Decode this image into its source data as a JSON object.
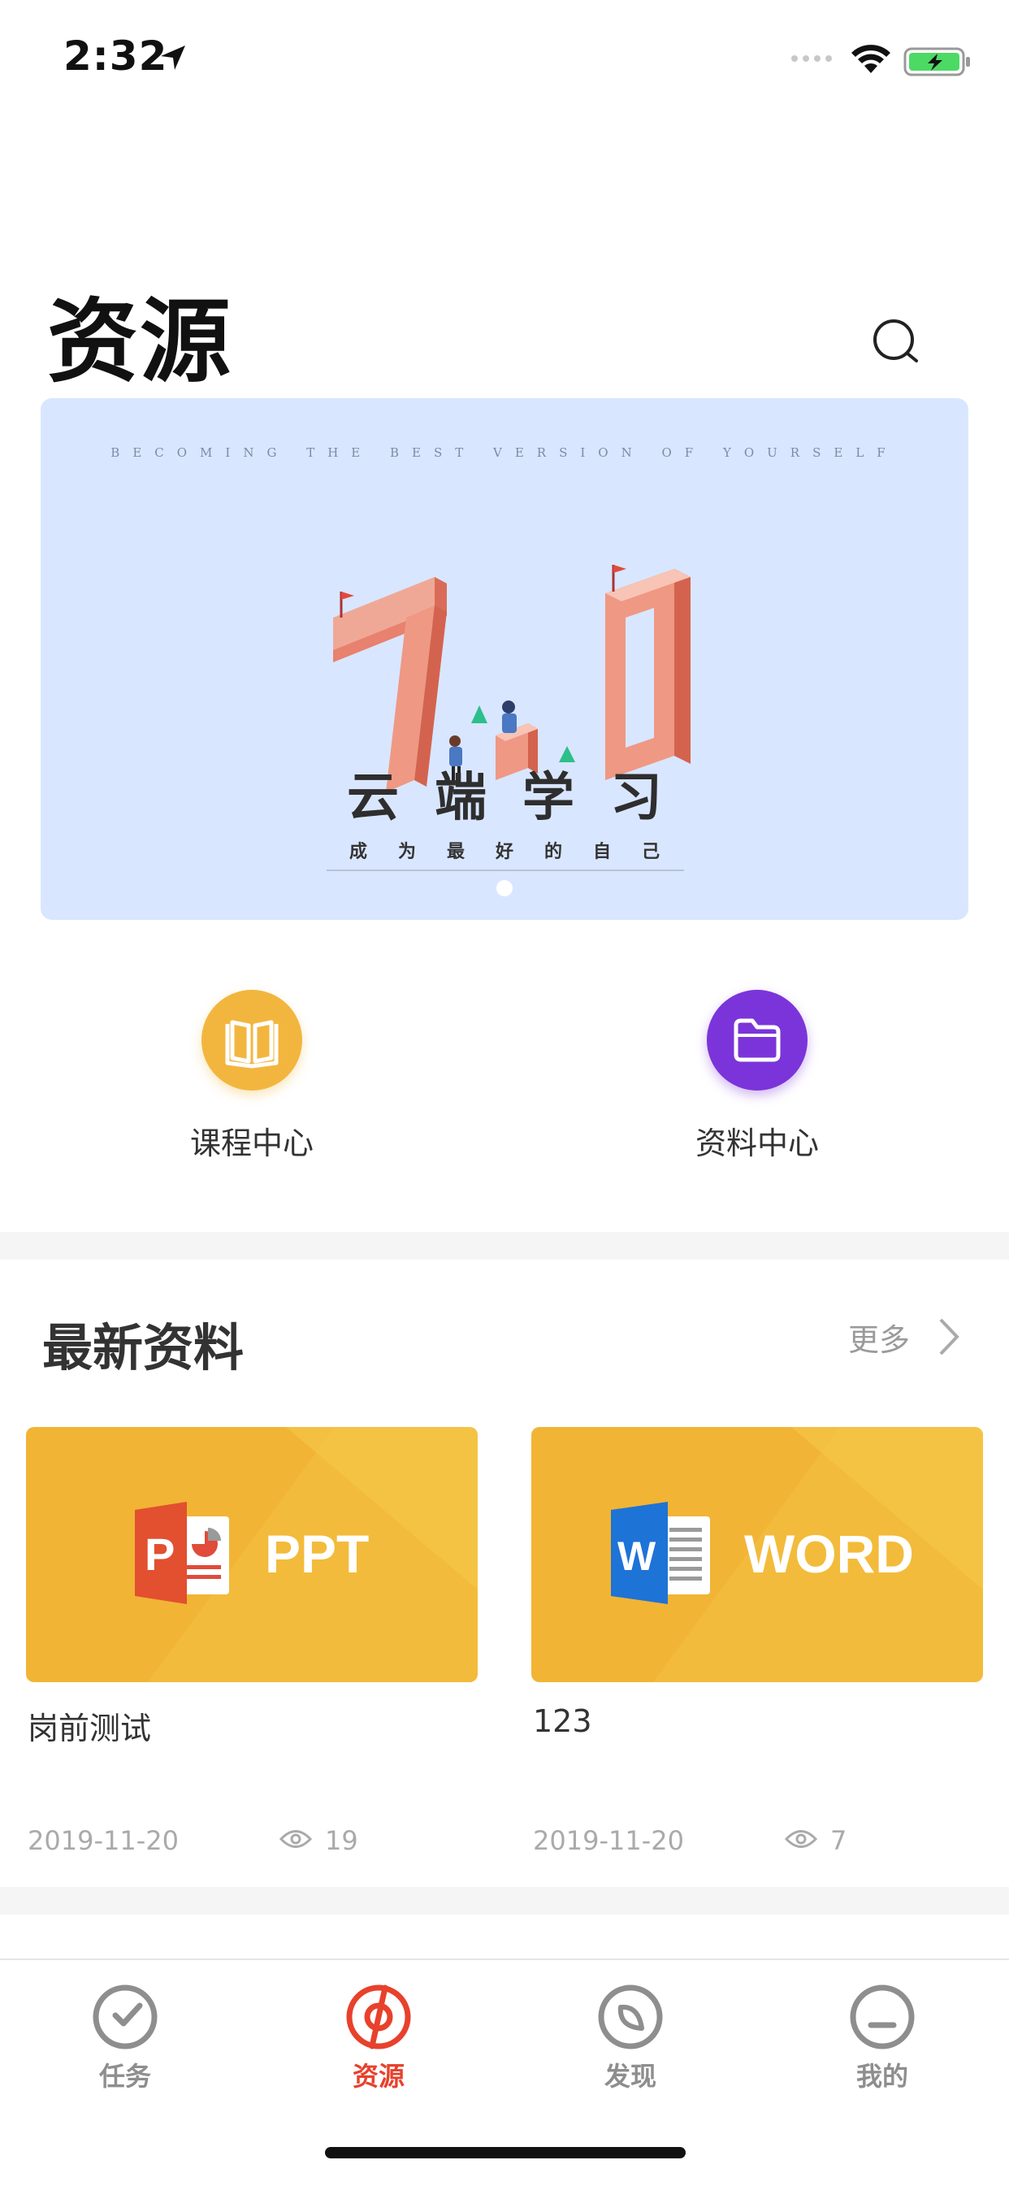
{
  "status_bar": {
    "time": "2:32",
    "icons": [
      "location-arrow-icon",
      "signal-icon",
      "wifi-icon",
      "battery-charging-icon"
    ]
  },
  "header": {
    "title": "资源",
    "search_icon": "search-icon"
  },
  "banner": {
    "tagline": "BECOMING THE BEST VERSION OF YOURSELF",
    "art_text": "7.0",
    "heading": "云端学习",
    "subtitle": "成为最好的自己",
    "page_indicator": {
      "count": 1,
      "active": 1
    },
    "bg_color": "#d9e6ff"
  },
  "shortcuts": [
    {
      "label": "课程中心",
      "icon": "book-icon",
      "color": "#f2b63f"
    },
    {
      "label": "资料中心",
      "icon": "folder-icon",
      "color": "#7b34d9"
    }
  ],
  "latest": {
    "title": "最新资料",
    "more_label": "更多",
    "items": [
      {
        "type_label": "PPT",
        "letter": "P",
        "icon": "powerpoint-icon",
        "title": "岗前测试",
        "date": "2019-11-20",
        "views": "19"
      },
      {
        "type_label": "WORD",
        "letter": "W",
        "icon": "word-icon",
        "title": "123",
        "date": "2019-11-20",
        "views": "7"
      }
    ]
  },
  "tabbar": {
    "active_color": "#e8412c",
    "items": [
      {
        "label": "任务",
        "icon": "task-clock-icon",
        "active": false
      },
      {
        "label": "资源",
        "icon": "resource-icon",
        "active": true
      },
      {
        "label": "发现",
        "icon": "discover-icon",
        "active": false
      },
      {
        "label": "我的",
        "icon": "profile-icon",
        "active": false
      }
    ]
  }
}
